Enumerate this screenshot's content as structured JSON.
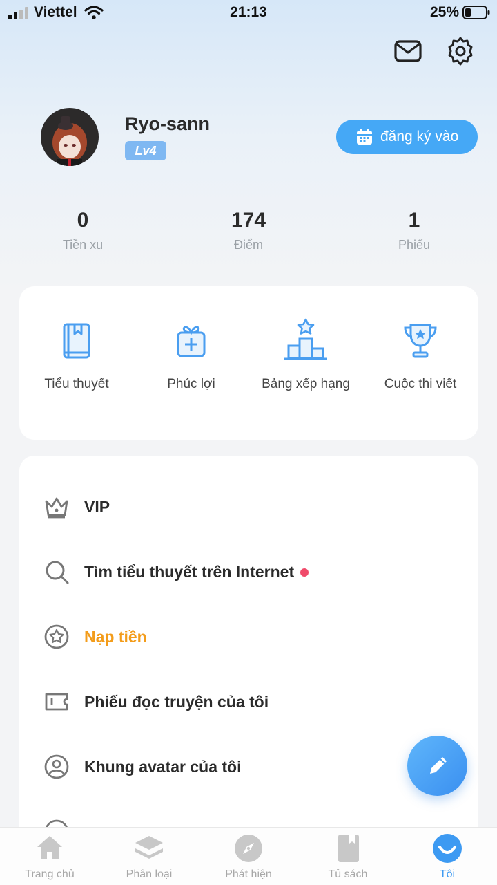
{
  "status_bar": {
    "carrier": "Viettel",
    "time": "21:13",
    "battery": "25%"
  },
  "profile": {
    "username": "Ryo-sann",
    "level": "Lv4",
    "checkin_label": "đăng ký vào"
  },
  "stats": [
    {
      "value": "0",
      "label": "Tiền xu"
    },
    {
      "value": "174",
      "label": "Điểm"
    },
    {
      "value": "1",
      "label": "Phiếu"
    }
  ],
  "grid": [
    {
      "label": "Tiểu thuyết",
      "icon": "book-icon"
    },
    {
      "label": "Phúc lợi",
      "icon": "gift-icon"
    },
    {
      "label": "Bảng xếp hạng",
      "icon": "podium-icon"
    },
    {
      "label": "Cuộc thi viết",
      "icon": "trophy-icon"
    }
  ],
  "menu": [
    {
      "label": "VIP",
      "icon": "crown-icon"
    },
    {
      "label": "Tìm tiểu thuyết trên Internet",
      "icon": "search-icon"
    },
    {
      "label": "Nạp tiền",
      "icon": "coin-star-icon"
    },
    {
      "label": "Phiếu đọc truyện của tôi",
      "icon": "ticket-icon"
    },
    {
      "label": "Khung avatar của tôi",
      "icon": "avatar-frame-icon"
    }
  ],
  "bottom_nav": [
    {
      "label": "Trang chủ",
      "icon": "home-icon"
    },
    {
      "label": "Phân loại",
      "icon": "layers-icon"
    },
    {
      "label": "Phát hiện",
      "icon": "compass-icon"
    },
    {
      "label": "Tủ sách",
      "icon": "bookshelf-icon"
    },
    {
      "label": "Tôi",
      "icon": "smile-icon"
    }
  ],
  "colors": {
    "accent": "#45a8f6",
    "topup": "#f39c1a",
    "dot": "#f04a6a",
    "nav_active": "#3d9af2"
  }
}
